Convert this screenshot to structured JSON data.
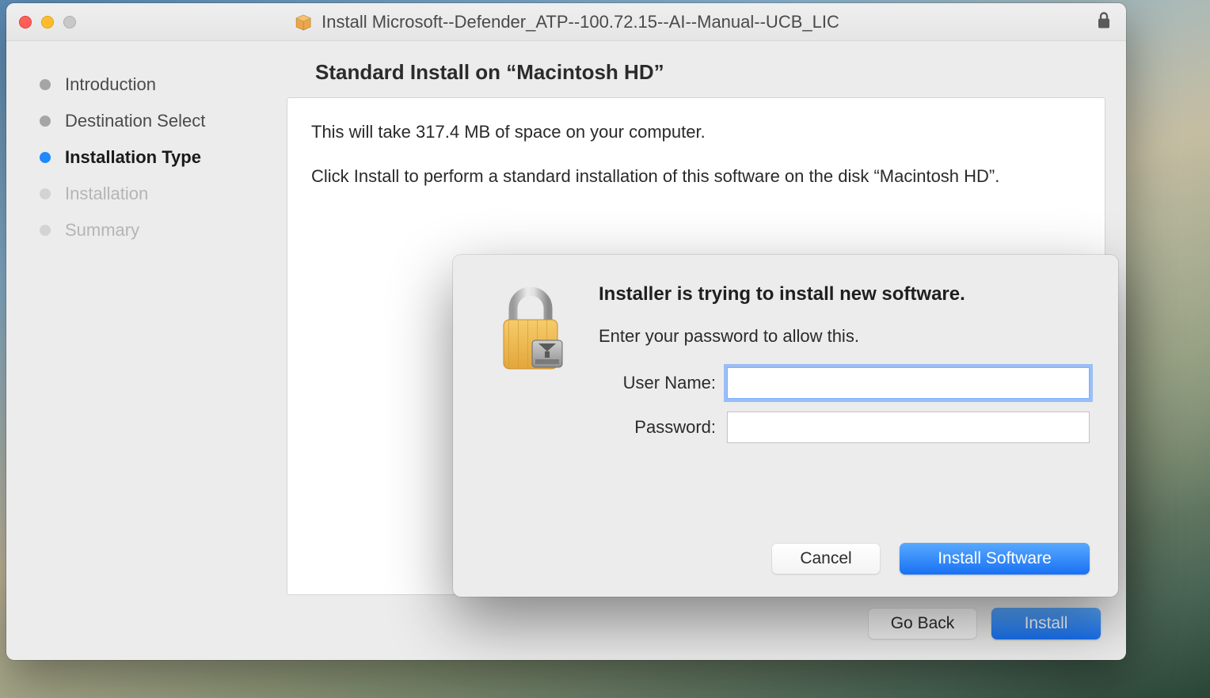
{
  "window": {
    "title": "Install Microsoft--Defender_ATP--100.72.15--AI--Manual--UCB_LIC"
  },
  "sidebar": {
    "items": [
      {
        "label": "Introduction",
        "state": "done"
      },
      {
        "label": "Destination Select",
        "state": "done"
      },
      {
        "label": "Installation Type",
        "state": "current"
      },
      {
        "label": "Installation",
        "state": "pending"
      },
      {
        "label": "Summary",
        "state": "pending"
      }
    ]
  },
  "main": {
    "heading": "Standard Install on “Macintosh HD”",
    "line1": "This will take 317.4 MB of space on your computer.",
    "line2": "Click Install to perform a standard installation of this software on the disk “Macintosh HD”."
  },
  "buttons": {
    "go_back": "Go Back",
    "install": "Install"
  },
  "auth": {
    "title": "Installer is trying to install new software.",
    "subtitle": "Enter your password to allow this.",
    "username_label": "User Name:",
    "password_label": "Password:",
    "username_value": "",
    "password_value": "",
    "cancel": "Cancel",
    "install_software": "Install Software"
  }
}
